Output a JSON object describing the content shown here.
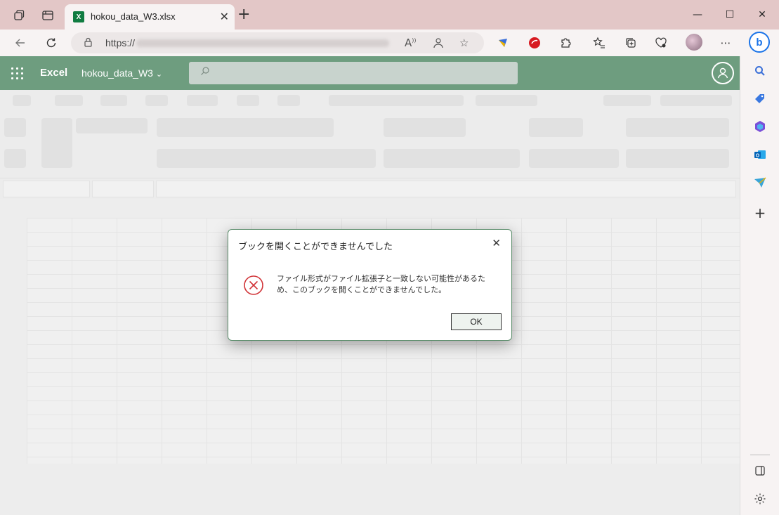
{
  "browser": {
    "tab_title": "hokou_data_W3.xlsx",
    "tab_icon_letter": "X",
    "new_tab_glyph": "+",
    "address_prefix": "https://",
    "window_controls": {
      "minimize": "—",
      "maximize": "☐",
      "close": "✕"
    },
    "colors": {
      "titlebar": "#e3c7c7",
      "excel_green": "#107c41"
    }
  },
  "excel": {
    "app_name": "Excel",
    "file_name": "hokou_data_W3",
    "header_color": "#6e9d7f"
  },
  "dialog": {
    "title": "ブックを開くことができませんでした",
    "message": "ファイル形式がファイル拡張子と一致しない可能性があるため、このブックを開くことができませんでした。",
    "ok_label": "OK",
    "icon": "error-circle-x-icon",
    "error_color": "#d13438"
  }
}
